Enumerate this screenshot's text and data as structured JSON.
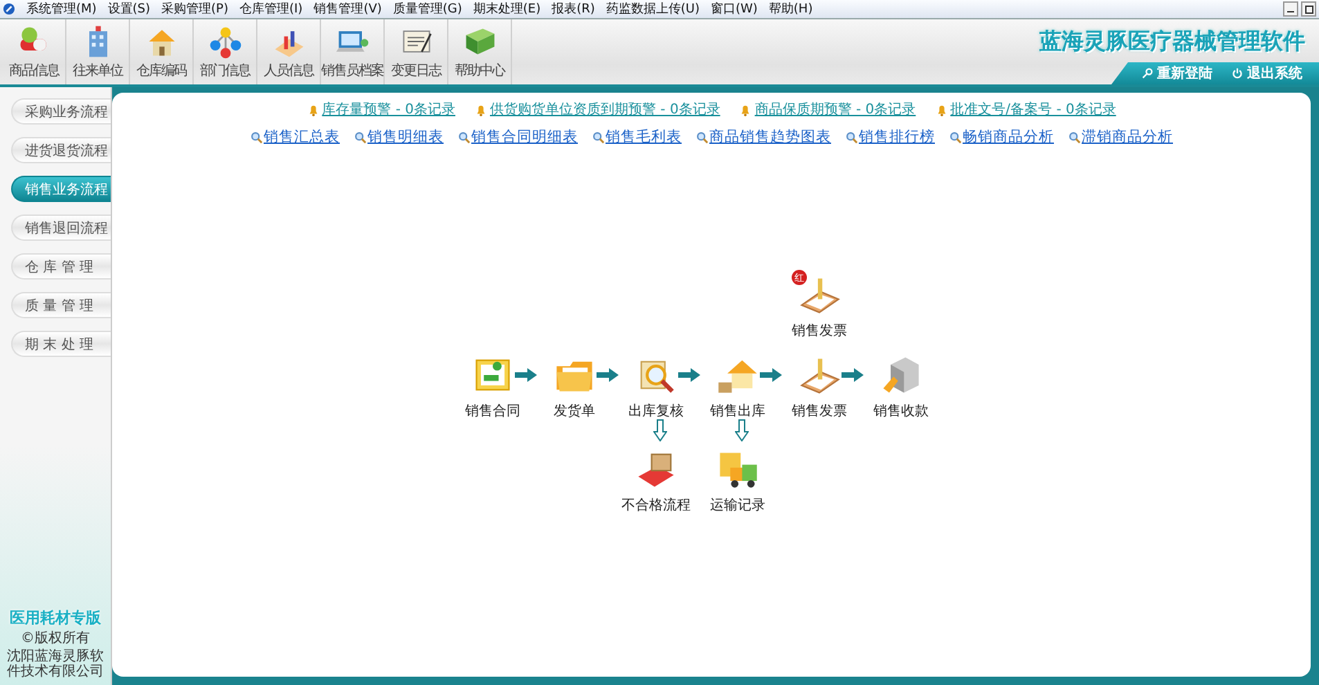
{
  "menu": [
    "系统管理(M)",
    "设置(S)",
    "采购管理(P)",
    "仓库管理(I)",
    "销售管理(V)",
    "质量管理(G)",
    "期末处理(E)",
    "报表(R)",
    "药监数据上传(U)",
    "窗口(W)",
    "帮助(H)"
  ],
  "toolbar": [
    "商品信息",
    "往来单位",
    "仓库编码",
    "部门信息",
    "人员信息",
    "销售员档案",
    "变更日志",
    "帮助中心"
  ],
  "app_title": "蓝海灵豚医疗器械管理软件",
  "header_buttons": [
    "重新登陆",
    "退出系统"
  ],
  "sidebar": {
    "items": [
      {
        "label": "采购业务流程",
        "selected": false
      },
      {
        "label": "进货退货流程",
        "selected": false
      },
      {
        "label": "销售业务流程",
        "selected": true
      },
      {
        "label": "销售退回流程",
        "selected": false
      },
      {
        "label": "仓 库 管 理",
        "selected": false
      },
      {
        "label": "质 量 管 理",
        "selected": false
      },
      {
        "label": "期 末 处 理",
        "selected": false
      }
    ],
    "edition": "医用耗材专版",
    "copyright": "©版权所有",
    "company": "沈阳蓝海灵豚软件技术有限公司"
  },
  "alerts": [
    "库存量预警 - 0条记录",
    "供货购货单位资质到期预警 - 0条记录",
    "商品保质期预警 - 0条记录",
    "批准文号/备案号 - 0条记录"
  ],
  "reports": [
    "销售汇总表",
    "销售明细表",
    "销售合同明细表",
    "销售毛利表",
    "商品销售趋势图表",
    "销售排行榜",
    "畅销商品分析",
    "滞销商品分析"
  ],
  "flow": {
    "steps": [
      {
        "label": "销售合同"
      },
      {
        "label": "发货单"
      },
      {
        "label": "出库复核",
        "below": {
          "label": "不合格流程"
        }
      },
      {
        "label": "销售出库",
        "below": {
          "label": "运输记录"
        }
      },
      {
        "label": "销售发票",
        "above": {
          "label": "销售发票",
          "badge": "红"
        }
      },
      {
        "label": "销售收款"
      }
    ]
  }
}
